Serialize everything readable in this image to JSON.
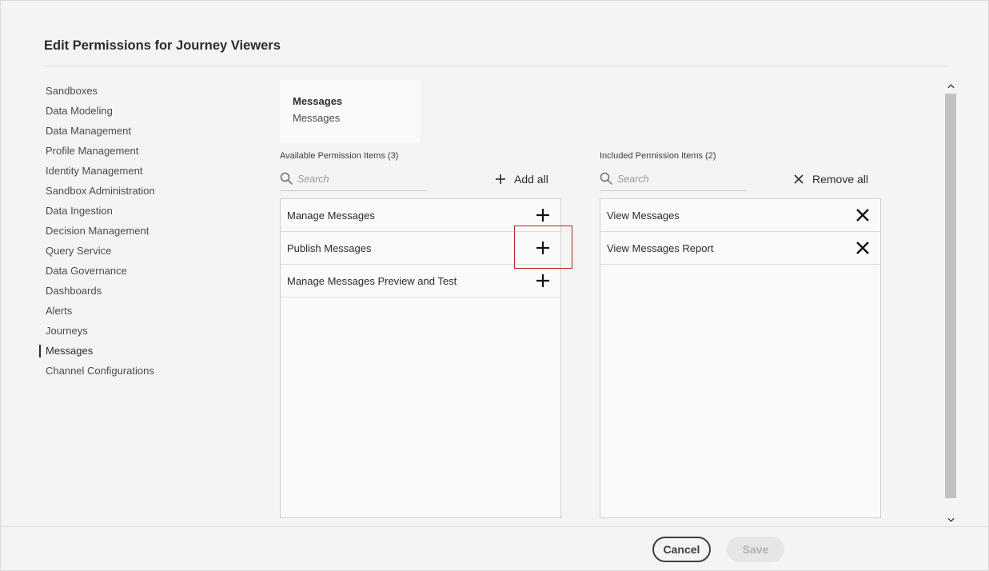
{
  "dialog": {
    "title": "Edit Permissions for Journey Viewers"
  },
  "nav": {
    "items": [
      {
        "label": "Sandboxes"
      },
      {
        "label": "Data Modeling"
      },
      {
        "label": "Data Management"
      },
      {
        "label": "Profile Management"
      },
      {
        "label": "Identity Management"
      },
      {
        "label": "Sandbox Administration"
      },
      {
        "label": "Data Ingestion"
      },
      {
        "label": "Decision Management"
      },
      {
        "label": "Query Service"
      },
      {
        "label": "Data Governance"
      },
      {
        "label": "Dashboards"
      },
      {
        "label": "Alerts"
      },
      {
        "label": "Journeys"
      },
      {
        "label": "Messages",
        "selected": true
      },
      {
        "label": "Channel Configurations"
      }
    ]
  },
  "category_card": {
    "title": "Messages",
    "subtitle": "Messages"
  },
  "available": {
    "label": "Available Permission Items (3)",
    "search_placeholder": "Search",
    "search_value": "",
    "add_all_label": "Add all",
    "items": [
      {
        "label": "Manage Messages"
      },
      {
        "label": "Publish Messages"
      },
      {
        "label": "Manage Messages Preview and Test"
      }
    ]
  },
  "included": {
    "label": "Included Permission Items (2)",
    "search_placeholder": "Search",
    "search_value": "",
    "remove_all_label": "Remove all",
    "items": [
      {
        "label": "View Messages"
      },
      {
        "label": "View Messages Report"
      }
    ]
  },
  "footer": {
    "cancel_label": "Cancel",
    "save_label": "Save"
  },
  "colors": {
    "highlight": "#b3222a",
    "background": "#f4f4f4"
  }
}
